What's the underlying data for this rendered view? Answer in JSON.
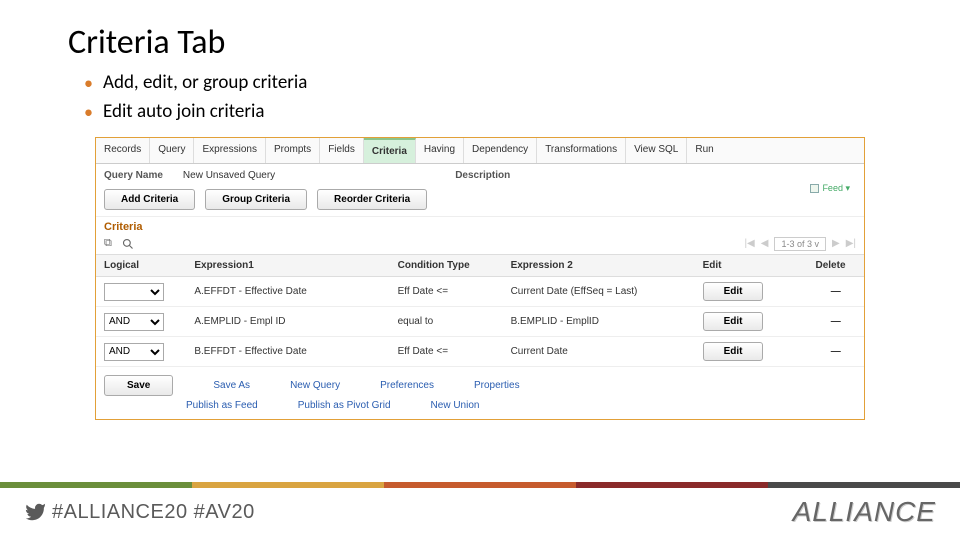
{
  "slide": {
    "title": "Criteria Tab",
    "bullet1": "Add, edit, or group criteria",
    "bullet2": "Edit auto join criteria"
  },
  "tabs": {
    "records": "Records",
    "query": "Query",
    "expressions": "Expressions",
    "prompts": "Prompts",
    "fields": "Fields",
    "criteria": "Criteria",
    "having": "Having",
    "dependency": "Dependency",
    "transformations": "Transformations",
    "viewsql": "View SQL",
    "run": "Run"
  },
  "queryRow": {
    "nameLabel": "Query Name",
    "nameValue": "New Unsaved Query",
    "descLabel": "Description",
    "feed": "Feed"
  },
  "buttons": {
    "add": "Add Criteria",
    "group": "Group Criteria",
    "reorder": "Reorder Criteria"
  },
  "section": {
    "criteria": "Criteria"
  },
  "pager": {
    "text": "1-3 of 3",
    "chev": "v"
  },
  "gridHeaders": {
    "logical": "Logical",
    "expr1": "Expression1",
    "cond": "Condition Type",
    "expr2": "Expression 2",
    "edit": "Edit",
    "delete": "Delete"
  },
  "rows": [
    {
      "logical": "",
      "expr1": "A.EFFDT - Effective Date",
      "cond": "Eff Date <=",
      "expr2": "Current Date (EffSeq = Last)",
      "edit": "Edit"
    },
    {
      "logical": "AND",
      "expr1": "A.EMPLID - Empl ID",
      "cond": "equal to",
      "expr2": "B.EMPLID - EmplID",
      "edit": "Edit"
    },
    {
      "logical": "AND",
      "expr1": "B.EFFDT - Effective Date",
      "cond": "Eff Date <=",
      "expr2": "Current Date",
      "edit": "Edit"
    }
  ],
  "links": {
    "save": "Save",
    "saveas": "Save As",
    "newquery": "New Query",
    "prefs": "Preferences",
    "props": "Properties",
    "publish": "Publish as Feed",
    "pivot": "Publish as Pivot Grid",
    "union": "New Union"
  },
  "footer": {
    "hash": "#ALLIANCE20 #AV20",
    "logo": "ALLIANCE"
  }
}
